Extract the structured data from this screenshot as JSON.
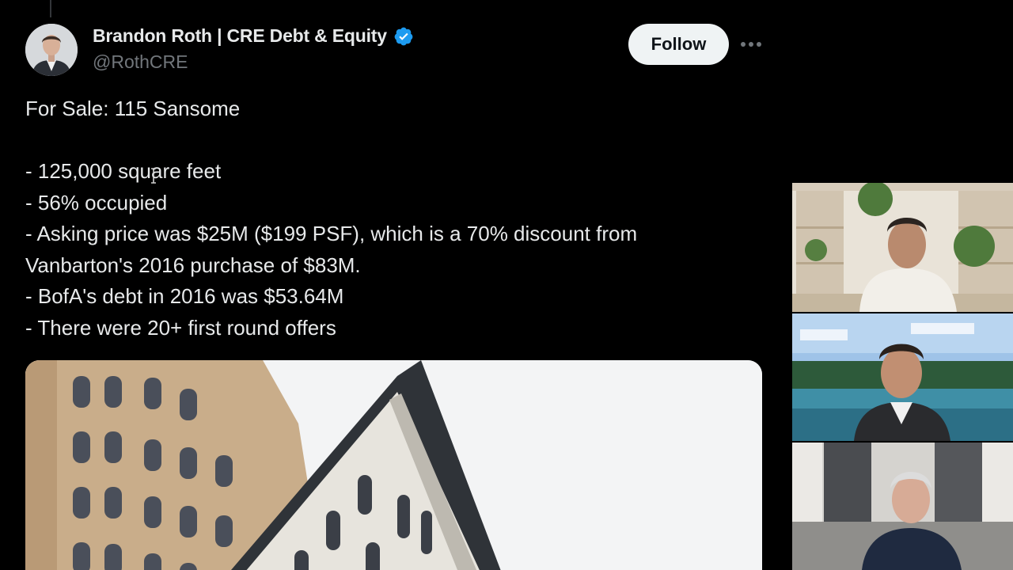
{
  "tweet": {
    "author": {
      "display_name": "Brandon Roth | CRE Debt & Equity",
      "handle": "@RothCRE",
      "verified": true,
      "verified_color": "#1d9bf0"
    },
    "follow_label": "Follow",
    "more_icon": "ellipsis-icon",
    "body_lines": [
      "For Sale: 115 Sansome",
      "",
      "- 125,000 square feet",
      "- 56% occupied",
      "- Asking price was $25M ($199 PSF), which is a 70% discount from",
      "Vanbarton's 2016 purchase of $83M.",
      "- BofA's debt in 2016 was $53.64M",
      "- There were 20+ first round offers"
    ]
  },
  "participants": [
    {
      "id": "participant-1"
    },
    {
      "id": "participant-2"
    },
    {
      "id": "participant-3"
    }
  ],
  "colors": {
    "background": "#000000",
    "text_primary": "#e7e9ea",
    "text_secondary": "#71767b",
    "follow_bg": "#eff3f4",
    "follow_text": "#0f1419"
  }
}
